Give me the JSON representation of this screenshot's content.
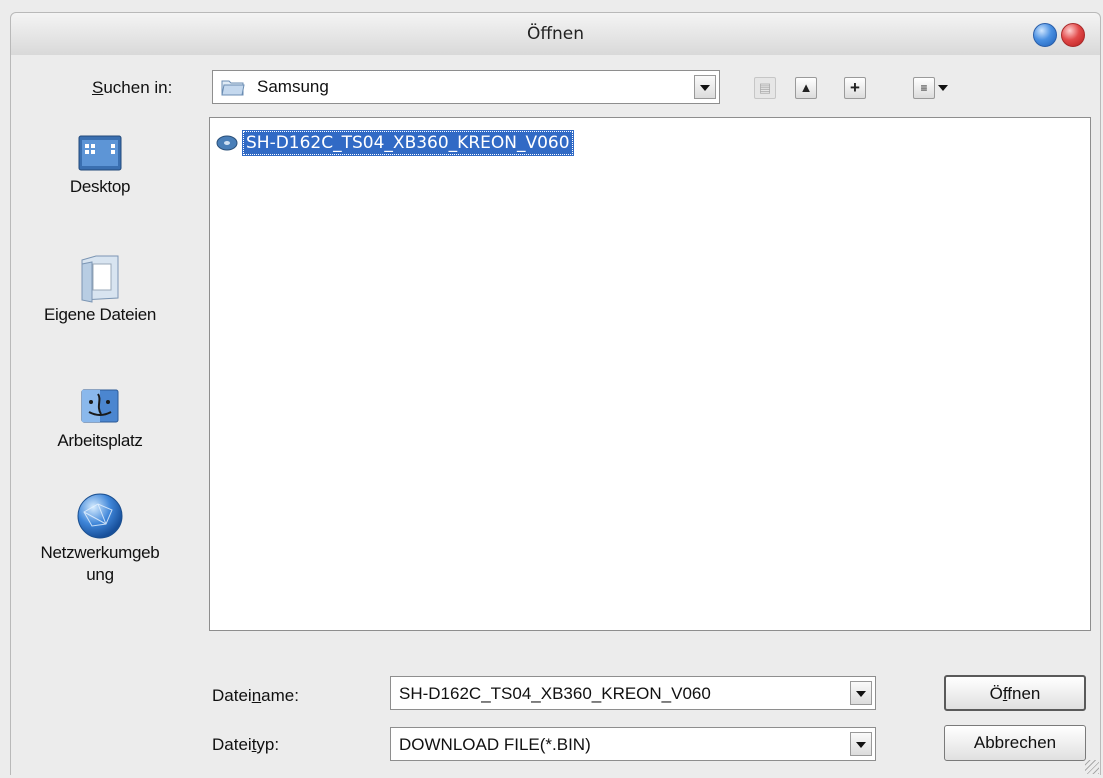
{
  "window": {
    "title": "Öffnen"
  },
  "lookin": {
    "label_prefix": "S",
    "label_rest": "uchen in:",
    "current_folder": "Samsung"
  },
  "places": [
    {
      "label": "Desktop",
      "icon": "desktop-icon"
    },
    {
      "label": "Eigene Dateien",
      "icon": "documents-folder-icon"
    },
    {
      "label": "Arbeitsplatz",
      "icon": "my-computer-icon"
    },
    {
      "label_line1": "Netzwerkumgeb",
      "label_line2": "ung",
      "icon": "network-globe-icon"
    }
  ],
  "files": [
    {
      "name": "SH-D162C_TS04_XB360_KREON_V060",
      "icon": "disc-image-icon",
      "selected": true
    }
  ],
  "filename": {
    "label_a": "Datei",
    "label_u": "n",
    "label_b": "ame:",
    "value": "SH-D162C_TS04_XB360_KREON_V060"
  },
  "filetype": {
    "label_a": "Datei",
    "label_u": "t",
    "label_b": "yp:",
    "value": "DOWNLOAD FILE(*.BIN)"
  },
  "buttons": {
    "open_pre": "Ö",
    "open_u": "f",
    "open_post": "fnen",
    "cancel": "Abbrechen"
  },
  "colors": {
    "selection": "#316ac5",
    "close": "#e24a4a",
    "minimize": "#4a90e2"
  }
}
